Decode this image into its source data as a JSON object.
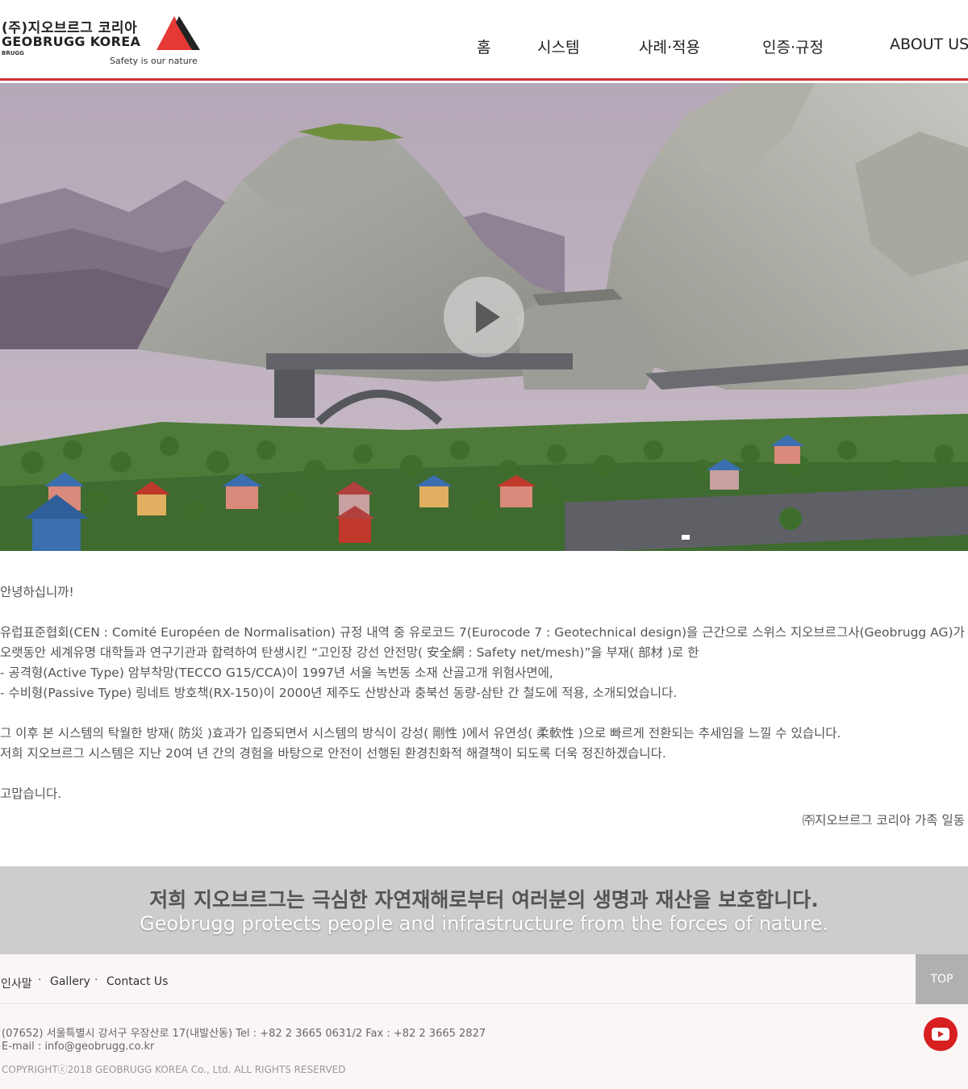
{
  "header": {
    "logo": {
      "korean": "(주)지오브르그 코리아",
      "english": "GEOBRUGG KOREA",
      "small": "BRUGG",
      "tagline": "Safety is our nature",
      "registered_mark": "®"
    },
    "nav": [
      "홈",
      "시스템",
      "사례·적용",
      "인증·규정",
      "ABOUT US"
    ],
    "accent_color": "#d32f2f"
  },
  "hero": {
    "play_icon": "play-icon",
    "state": "paused"
  },
  "greeting": {
    "lines": [
      "안녕하십니까!",
      "",
      "유럽표준협회(CEN : Comité Européen de Normalisation) 규정 내역 중 유로코드 7(Eurocode 7 : Geotechnical design)을 근간으로 스위스 지오브르그사(Geobrugg AG)가",
      "오랫동안 세계유명 대학들과 연구기관과 합력하여 탄생시킨 “고인장 강선 안전망( 安全網 : Safety net/mesh)”을 부재( 部材 )로 한",
      "- 공격형(Active Type) 암부착망(TECCO G15/CCA)이 1997년 서울 녹번동 소재 산골고개 위험사면에,",
      "- 수비형(Passive Type) 링네트 방호책(RX-150)이 2000년 제주도 산방산과 충북선 동량-삼탄 간 철도에 적용, 소개되었습니다.",
      "",
      "그 이후 본 시스템의 탁월한 방재( 防災 )효과가 입증되면서 시스템의 방식이 강성( 剛性 )에서 유연성( 柔軟性 )으로 빠르게 전환되는 추세임을 느낄 수 있습니다.",
      "저희 지오브르그 시스템은 지난 20여 년 간의 경험을 바탕으로 안전이 선행된 환경친화적 해결책이 되도록 더욱 정진하겠습니다.",
      "",
      "고맙습니다."
    ],
    "signature": "㈜지오브르그 코리아 가족 일동"
  },
  "banner": {
    "korean": "저희 지오브르그는 극심한 자연재해로부터 여러분의 생명과 재산을 보호합니다.",
    "english": "Geobrugg protects people and infrastructure from the forces of nature."
  },
  "footer": {
    "links": [
      "인사말",
      "Gallery",
      "Contact Us"
    ],
    "separator": "·",
    "top_label": "TOP",
    "address": "(07652) 서울특별시 강서구 우장산로 17(내발산동)    Tel : +82 2 3665 0631/2    Fax : +82 2 3665 2827",
    "email": "E-mail : info@geobrugg.co.kr",
    "copyright": "COPYRIGHTⓒ2018 GEOBRUGG KOREA Co., Ltd. ALL RIGHTS RESERVED",
    "youtube_icon": "youtube-icon",
    "youtube_color": "#d71f1f"
  }
}
